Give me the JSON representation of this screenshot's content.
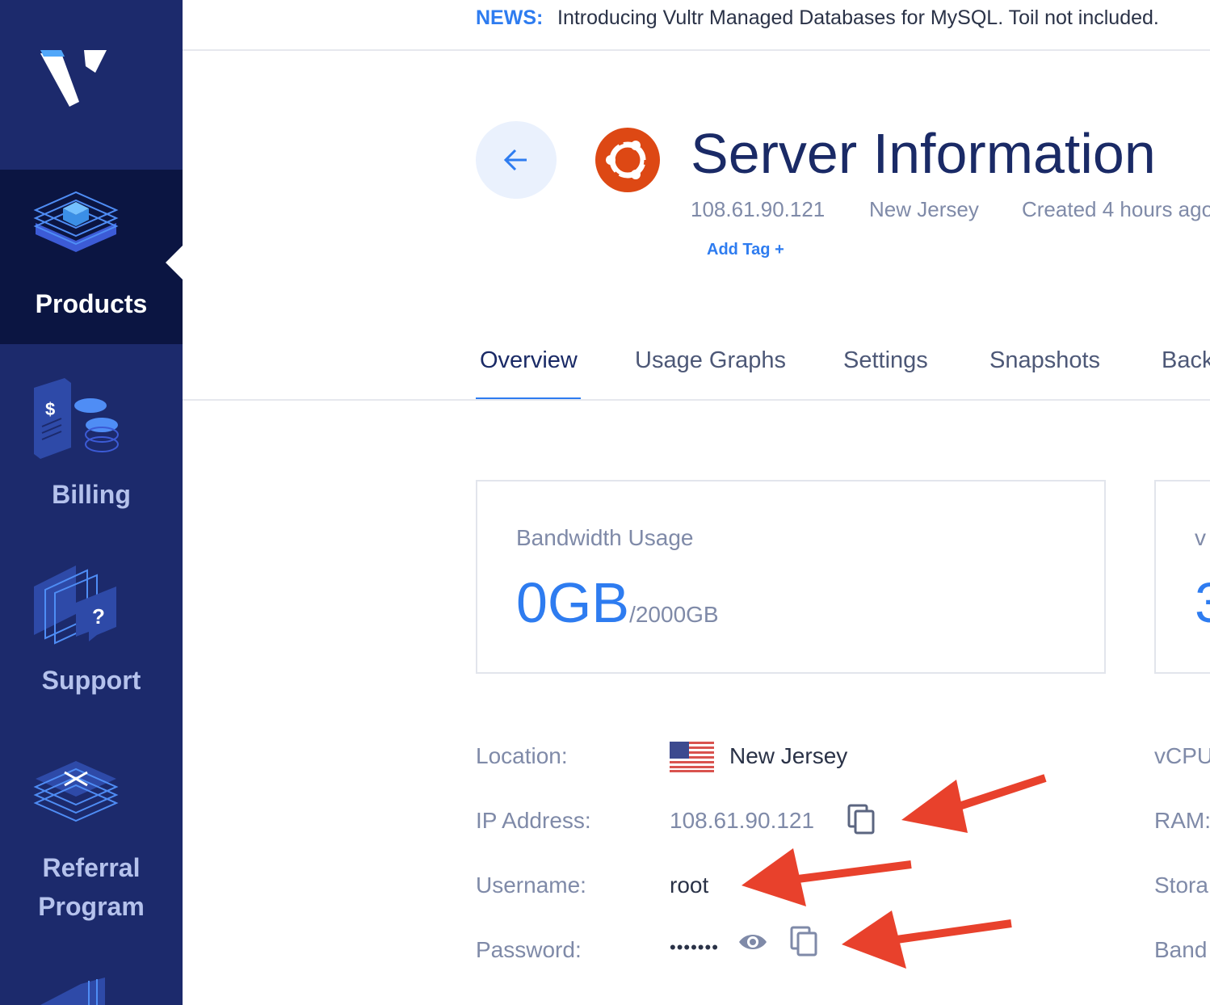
{
  "news": {
    "label": "NEWS:",
    "text": "Introducing Vultr Managed Databases for MySQL. Toil not included."
  },
  "sidebar": {
    "items": [
      {
        "label": "Products",
        "icon": "products-icon",
        "active": true
      },
      {
        "label": "Billing",
        "icon": "billing-icon",
        "active": false
      },
      {
        "label": "Support",
        "icon": "support-icon",
        "active": false
      },
      {
        "label": "Referral",
        "label2": "Program",
        "icon": "referral-icon",
        "active": false
      }
    ]
  },
  "header": {
    "title": "Server Information",
    "ip": "108.61.90.121",
    "location": "New Jersey",
    "created": "Created 4 hours ago",
    "add_tag": "Add Tag +"
  },
  "tabs": [
    {
      "label": "Overview",
      "active": true
    },
    {
      "label": "Usage Graphs",
      "active": false
    },
    {
      "label": "Settings",
      "active": false
    },
    {
      "label": "Snapshots",
      "active": false
    },
    {
      "label": "Back",
      "active": false
    }
  ],
  "cards": {
    "bandwidth": {
      "title": "Bandwidth Usage",
      "value": "0GB",
      "limit": "/2000GB"
    },
    "second": {
      "title": "v",
      "value": "3"
    }
  },
  "info": {
    "location_label": "Location:",
    "location_value": "New Jersey",
    "ip_label": "IP Address:",
    "ip_value": "108.61.90.121",
    "username_label": "Username:",
    "username_value": "root",
    "password_label": "Password:",
    "password_value": "•••••••"
  },
  "info_right": {
    "vcpu_label": "vCPU",
    "ram_label": "RAM:",
    "storage_label": "Stora",
    "bandwidth_label": "Band"
  },
  "colors": {
    "sidebar": "#1c2a6c",
    "sidebar_active": "#0b1542",
    "accent": "#2e7cf0",
    "ubuntu": "#dd4814",
    "annotation_arrow": "#e8412c"
  }
}
